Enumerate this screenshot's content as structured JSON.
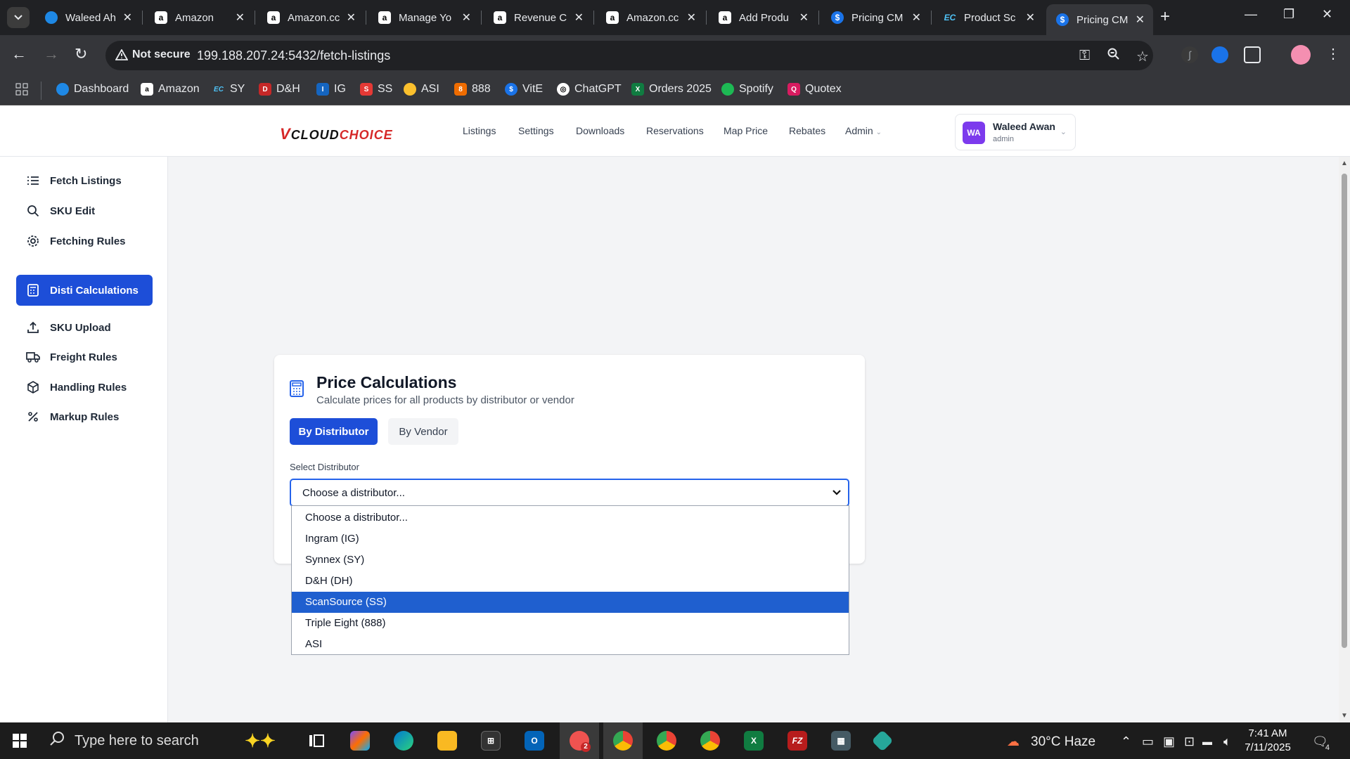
{
  "browser": {
    "tabs": [
      {
        "title": "Waleed Ah",
        "icon": "vcloud-icon",
        "color": "#4fc3f7"
      },
      {
        "title": "Amazon",
        "icon": "amazon-icon",
        "color": "#ffffff"
      },
      {
        "title": "Amazon.cc",
        "icon": "amazon-icon",
        "color": "#ffffff"
      },
      {
        "title": "Manage Yo",
        "icon": "amazon-icon",
        "color": "#ffffff"
      },
      {
        "title": "Revenue C",
        "icon": "amazon-icon",
        "color": "#ffffff"
      },
      {
        "title": "Amazon.cc",
        "icon": "amazon-icon",
        "color": "#ffffff"
      },
      {
        "title": "Add Produ",
        "icon": "amazon-icon",
        "color": "#ffffff"
      },
      {
        "title": "Pricing CM",
        "icon": "dollar-icon",
        "color": "#1a73e8"
      },
      {
        "title": "Product Sc",
        "icon": "ec-icon",
        "color": "#1a73e8"
      },
      {
        "title": "Pricing CM",
        "icon": "dollar-icon",
        "color": "#1a73e8"
      }
    ],
    "not_secure": "Not secure",
    "url": "199.188.207.24:5432/fetch-listings",
    "bookmarks": [
      "Dashboard",
      "Amazon",
      "SY",
      "D&H",
      "IG",
      "SS",
      "ASI",
      "888",
      "VitE",
      "ChatGPT",
      "Orders 2025",
      "Spotify",
      "Quotex"
    ]
  },
  "header": {
    "logo_v": "V",
    "logo_cloud": "CLOUD",
    "logo_choice": "CHOICE",
    "nav": [
      "Listings",
      "Settings",
      "Downloads",
      "Reservations",
      "Map Price",
      "Rebates",
      "Admin"
    ],
    "user": {
      "initials": "WA",
      "name": "Waleed Awan",
      "role": "admin"
    }
  },
  "sidebar": {
    "items": [
      {
        "label": "Fetch Listings",
        "icon": "list-icon"
      },
      {
        "label": "SKU Edit",
        "icon": "search-icon"
      },
      {
        "label": "Fetching Rules",
        "icon": "gear-icon"
      },
      {
        "label": "Disti Calculations",
        "icon": "calculator-icon"
      },
      {
        "label": "SKU Upload",
        "icon": "upload-icon"
      },
      {
        "label": "Freight Rules",
        "icon": "truck-icon"
      },
      {
        "label": "Handling Rules",
        "icon": "box-icon"
      },
      {
        "label": "Markup Rules",
        "icon": "percent-icon"
      }
    ]
  },
  "card": {
    "title": "Price Calculations",
    "subtitle": "Calculate prices for all products by distributor or vendor",
    "btn_distributor": "By Distributor",
    "btn_vendor": "By Vendor",
    "select_label": "Select Distributor",
    "select_value": "Choose a distributor...",
    "options": [
      "Choose a distributor...",
      "Ingram (IG)",
      "Synnex (SY)",
      "D&H (DH)",
      "ScanSource (SS)",
      "Triple Eight (888)",
      "ASI"
    ],
    "highlighted_option": "ScanSource (SS)"
  },
  "taskbar": {
    "search_placeholder": "Type here to search",
    "weather": "30°C  Haze",
    "time": "7:41 AM",
    "date": "7/11/2025",
    "notification_count": "4",
    "outlook_badge": "2"
  },
  "colors": {
    "accent": "#1d4ed8",
    "highlight": "#1f5fcf",
    "avatar": "#7c3aed",
    "brand_red": "#d62828"
  }
}
